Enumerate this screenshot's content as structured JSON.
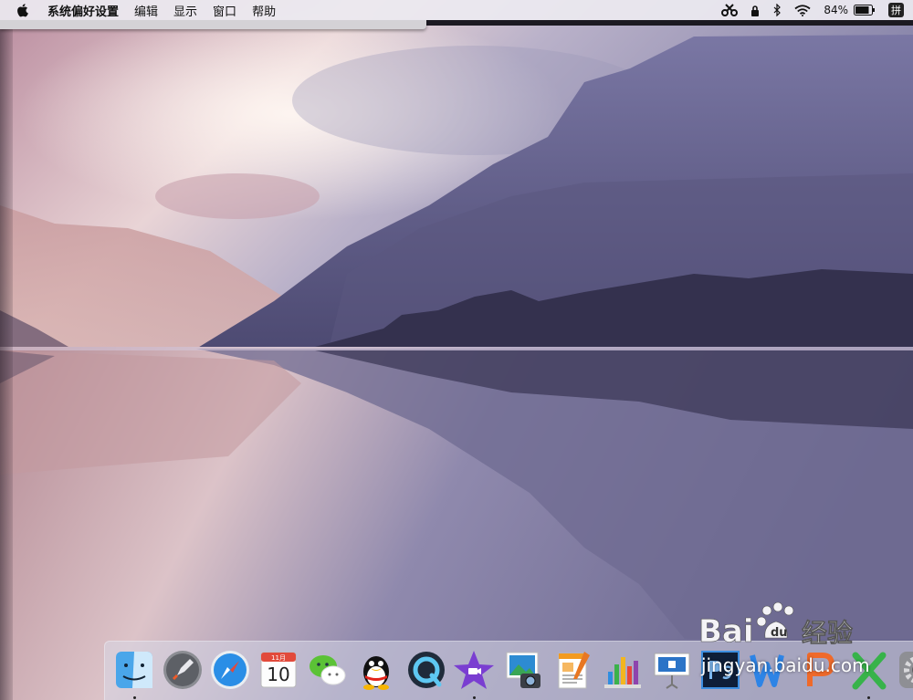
{
  "menubar": {
    "app_name": "系统偏好设置",
    "menus": [
      "编辑",
      "显示",
      "窗口",
      "帮助"
    ],
    "battery_percent": "84%",
    "input_method": "拼",
    "status_icons": [
      "scissors-icon",
      "lock-icon",
      "bluetooth-icon",
      "wifi-icon",
      "battery-icon"
    ]
  },
  "dock": {
    "calendar": {
      "month": "11月",
      "day": "10"
    },
    "apps": [
      "finder",
      "launchpad",
      "safari",
      "calendar",
      "wechat",
      "qq",
      "quicktime",
      "imovie",
      "iphoto",
      "pages",
      "numbers",
      "keynote",
      "photoshop",
      "wps-writer",
      "wps-presentation",
      "wps-spreadsheet",
      "system-preferences"
    ]
  },
  "watermark": {
    "url": "jingyan.baidu.com"
  },
  "colors": {
    "menubar_bg": "#eceaf0",
    "mountain_dark": "#3b3858",
    "sky_pink": "#d9b7c0"
  }
}
